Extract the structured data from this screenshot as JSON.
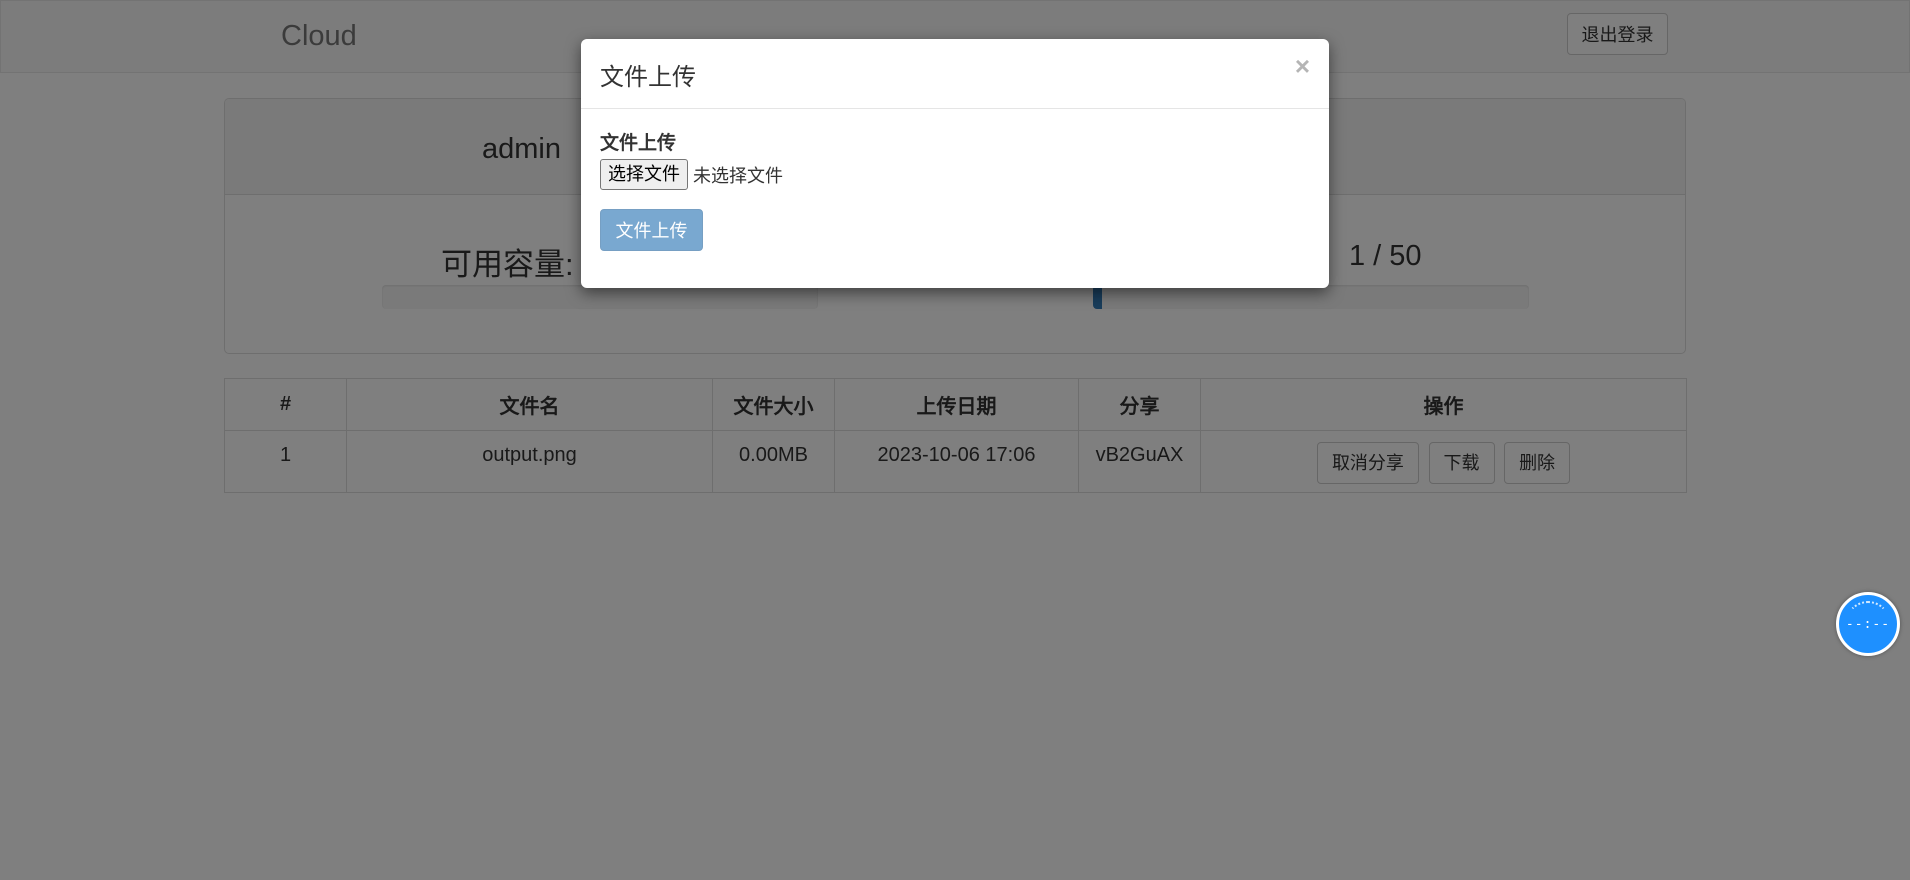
{
  "navbar": {
    "brand": "Cloud",
    "logout_label": "退出登录"
  },
  "user_panel": {
    "username": "admin",
    "capacity_label": "可用容量:",
    "capacity_fill": 0.0,
    "file_count_text": "1 / 50",
    "file_count_fill": 0.02
  },
  "file_table": {
    "headers": [
      "#",
      "文件名",
      "文件大小",
      "上传日期",
      "分享",
      "操作"
    ],
    "rows": [
      {
        "index": "1",
        "name": "output.png",
        "size": "0.00MB",
        "date": "2023-10-06 17:06",
        "share": "vB2GuAX",
        "actions": [
          "取消分享",
          "下载",
          "删除"
        ]
      }
    ]
  },
  "modal": {
    "title": "文件上传",
    "close_glyph": "×",
    "field_label": "文件上传",
    "choose_file_label": "选择文件",
    "no_file_text": "未选择文件",
    "submit_label": "文件上传"
  },
  "float_widget": {
    "time_text": "--:--"
  },
  "colors": {
    "primary": "#337ab7",
    "backdrop": "rgba(0,0,0,0.5)",
    "widget": "#1e90ff"
  }
}
